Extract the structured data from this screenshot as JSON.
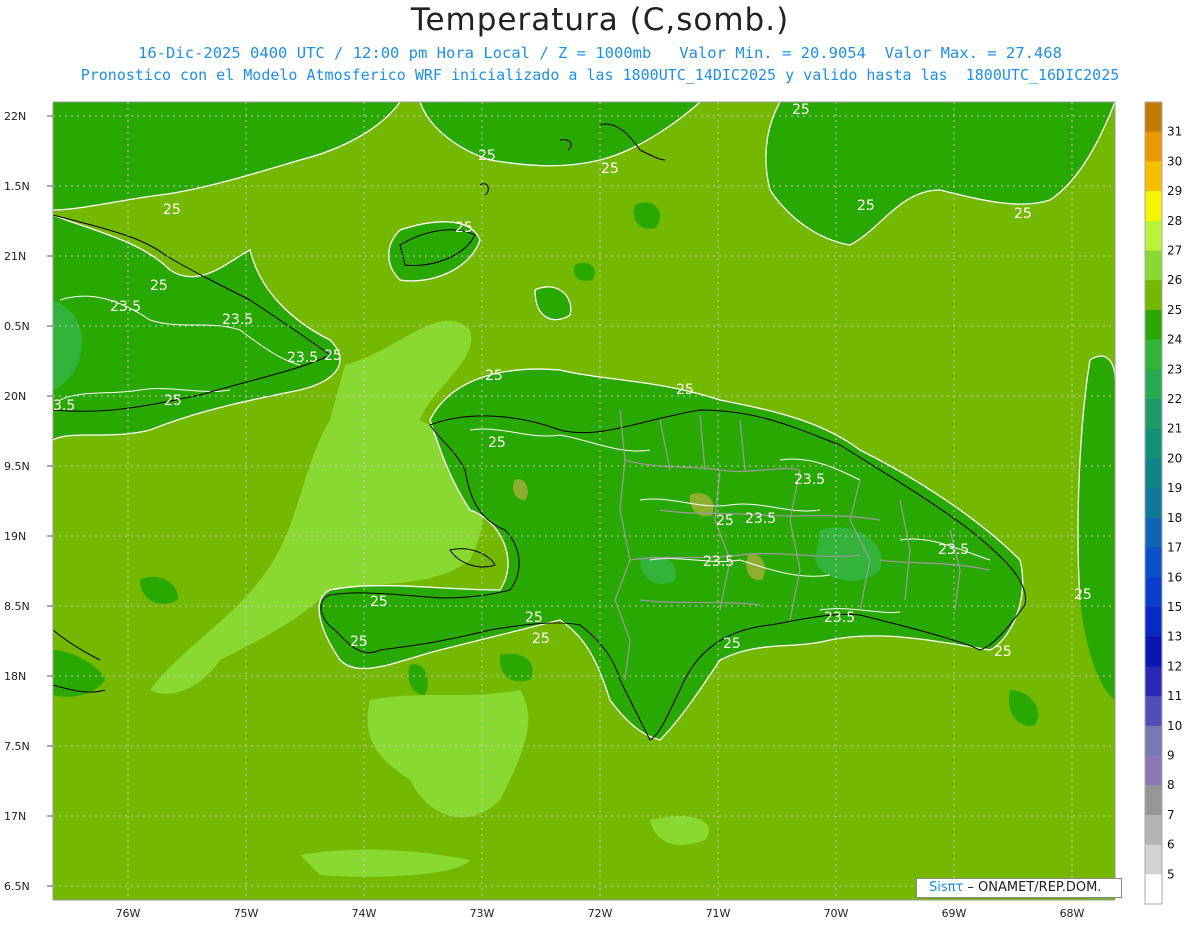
{
  "title": "Temperatura (C,somb.)",
  "subtitle1": "16-Dic-2025 0400 UTC / 12:00 pm Hora Local / Z = 1000mb   Valor Min. = 20.9054  Valor Max. = 27.468",
  "subtitle2": "Pronostico con el Modelo Atmosferico WRF inicializado a las 1800UTC_14DIC2025 y valido hasta las  1800UTC_16DIC2025",
  "lat_labels": [
    "22N",
    "1.5N",
    "21N",
    "0.5N",
    "20N",
    "9.5N",
    "19N",
    "8.5N",
    "18N",
    "7.5N",
    "17N",
    "6.5N"
  ],
  "lon_labels": [
    "76W",
    "75W",
    "74W",
    "73W",
    "72W",
    "71W",
    "70W",
    "69W",
    "68W"
  ],
  "contour_labels": {
    "c25": "25",
    "c235": "23.5",
    "c35": "3.5"
  },
  "colorbar": {
    "values": [
      "31",
      "30",
      "29",
      "28",
      "27",
      "26",
      "25",
      "24",
      "23",
      "22",
      "21",
      "20",
      "19",
      "18",
      "17",
      "16",
      "15",
      "13",
      "12",
      "11",
      "10",
      "9",
      "8",
      "7",
      "6",
      "5"
    ],
    "colors": [
      "#c47a00",
      "#e89a00",
      "#f5be00",
      "#f5f500",
      "#b8f53a",
      "#8ad832",
      "#74b800",
      "#28a800",
      "#32b43a",
      "#28aa50",
      "#1e9b69",
      "#139078",
      "#108488",
      "#10799a",
      "#0f64b4",
      "#0a50c8",
      "#0a3ccd",
      "#0a28c3",
      "#0a14b4",
      "#2828b4",
      "#5050b4",
      "#7878b4",
      "#8c78b4",
      "#969696",
      "#b4b4b4",
      "#d2d2d2",
      "#ffffff"
    ]
  },
  "credit": {
    "sis": "Sisπτ",
    "org": " – ONAMET/REP.DOM."
  }
}
